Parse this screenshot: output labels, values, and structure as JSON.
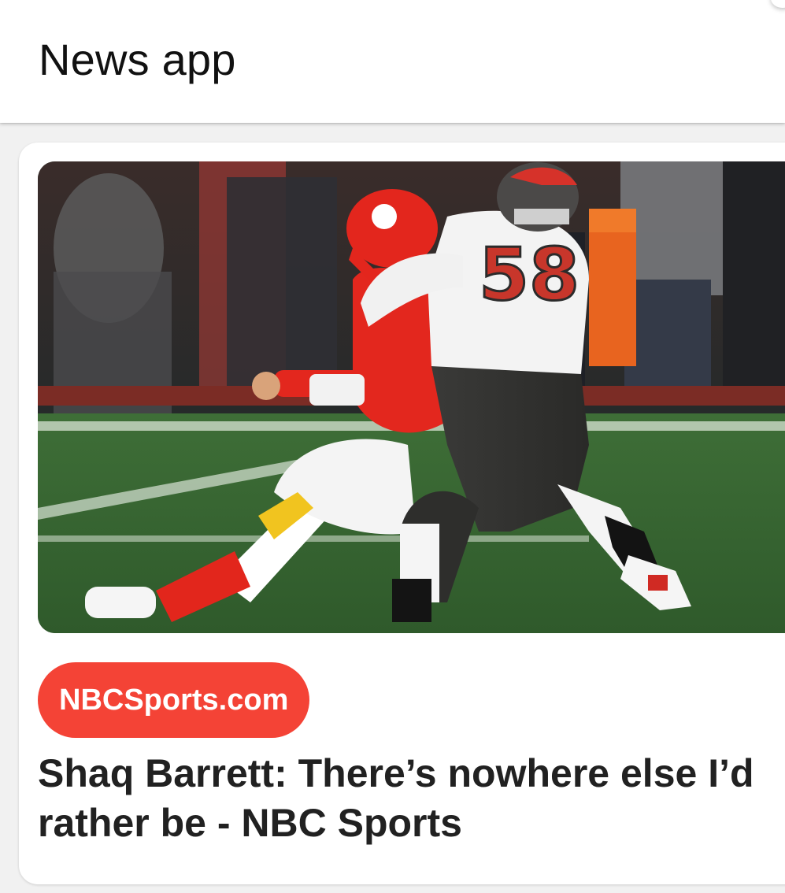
{
  "app_bar": {
    "title": "News app"
  },
  "article": {
    "image": {
      "subject": "football-tackle-photo",
      "jersey_number": "58"
    },
    "source": "NBCSports.com",
    "headline": "Shaq Barrett: There’s nowhere else I’d rather be - NBC Sports"
  },
  "colors": {
    "chip_background": "#f44336",
    "chip_text": "#ffffff",
    "headline_text": "#212121",
    "title_text": "#111111",
    "page_background": "#f1f1f1"
  }
}
